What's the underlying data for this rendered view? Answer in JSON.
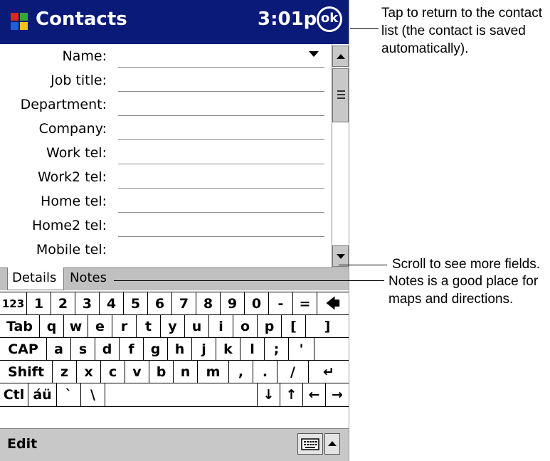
{
  "titlebar": {
    "app_title": "Contacts",
    "clock": "3:01p",
    "ok_label": "ok"
  },
  "form": {
    "fields": [
      {
        "label": "Name:"
      },
      {
        "label": "Job title:"
      },
      {
        "label": "Department:"
      },
      {
        "label": "Company:"
      },
      {
        "label": "Work tel:"
      },
      {
        "label": "Work2 tel:"
      },
      {
        "label": "Home tel:"
      },
      {
        "label": "Home2 tel:"
      },
      {
        "label": "Mobile tel:"
      }
    ]
  },
  "tabs": {
    "details": "Details",
    "notes": "Notes"
  },
  "keyboard": {
    "row1": [
      "123",
      "1",
      "2",
      "3",
      "4",
      "5",
      "6",
      "7",
      "8",
      "9",
      "0",
      "-",
      "=",
      "🡄"
    ],
    "row2": [
      "Tab",
      "q",
      "w",
      "e",
      "r",
      "t",
      "y",
      "u",
      "i",
      "o",
      "p",
      "[",
      "]"
    ],
    "row3": [
      "CAP",
      "a",
      "s",
      "d",
      "f",
      "g",
      "h",
      "j",
      "k",
      "l",
      ";",
      "'"
    ],
    "row4": [
      "Shift",
      "z",
      "x",
      "c",
      "v",
      "b",
      "n",
      "m",
      ",",
      ".",
      "/",
      "↵"
    ],
    "row5": [
      "Ctl",
      "áü",
      "`",
      "\\",
      "",
      "↓",
      "↑",
      "←",
      "→"
    ]
  },
  "menubar": {
    "edit": "Edit"
  },
  "callouts": {
    "ok_note_line1": "Tap to return to the contact",
    "ok_note_line2": "list (the contact is saved",
    "ok_note_line3": "automatically).",
    "scroll_note": "Scroll to see more fields.",
    "notes_note_line1": "Notes is a good place for",
    "notes_note_line2": "maps and directions."
  },
  "colors": {
    "titlebar": "#0a1a78",
    "chrome_gray": "#c0c0c0"
  }
}
